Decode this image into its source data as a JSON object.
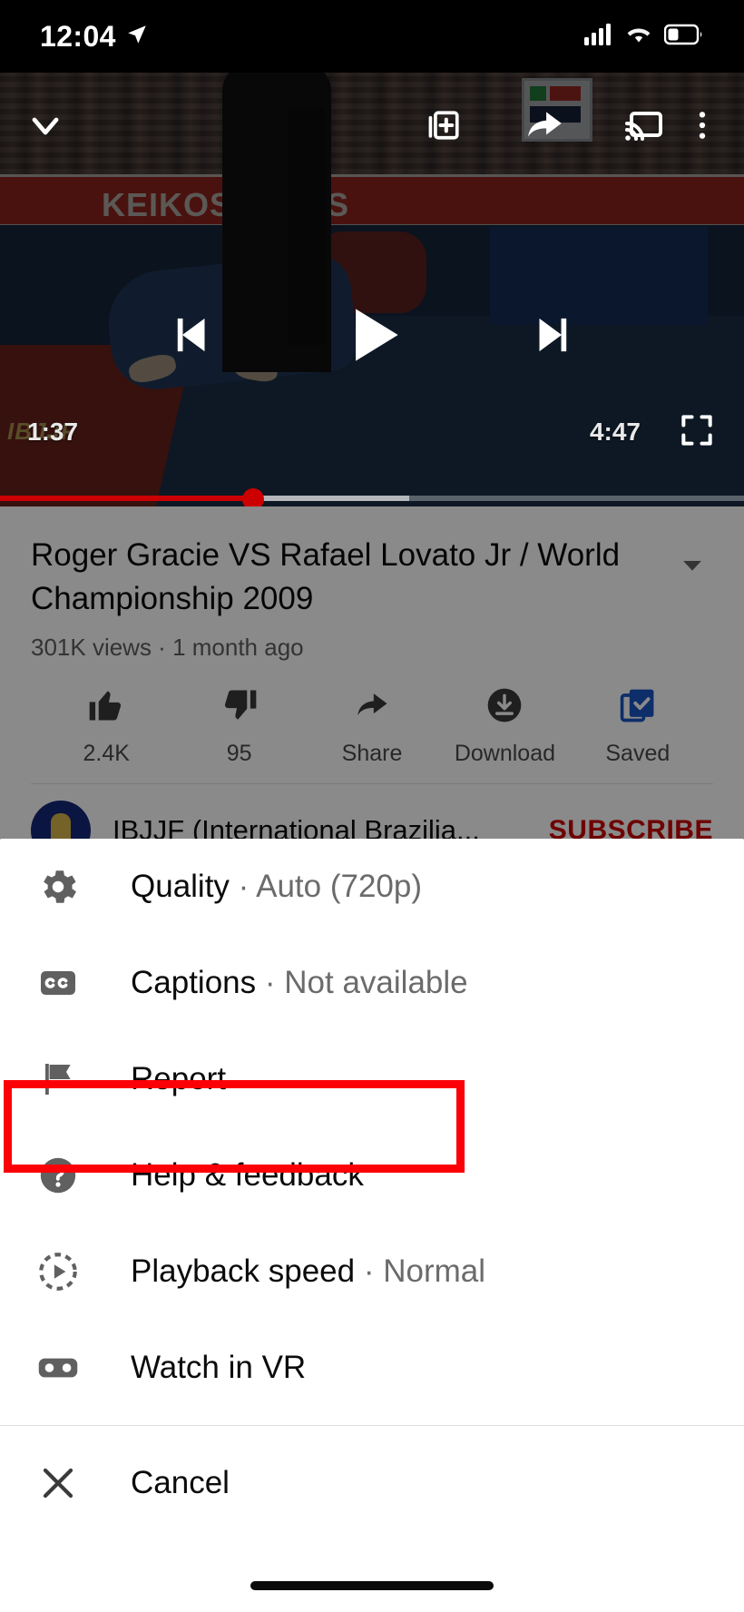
{
  "status_bar": {
    "time": "12:04",
    "location_icon": "location-arrow-icon",
    "signal_icon": "cellular-signal-icon",
    "wifi_icon": "wifi-icon",
    "battery_icon": "battery-low-icon",
    "battery_level_percent": 30
  },
  "player": {
    "collapse_icon": "chevron-down-icon",
    "add_to_playlist_icon": "add-to-queue-icon",
    "share_icon": "share-arrow-icon",
    "cast_icon": "cast-icon",
    "more_icon": "more-vertical-icon",
    "previous_icon": "previous-track-icon",
    "play_icon": "play-icon",
    "next_icon": "next-track-icon",
    "current_time": "1:37",
    "duration": "4:47",
    "fullscreen_icon": "fullscreen-icon",
    "progress_percent": 34,
    "buffered_percent": 55,
    "accent_color": "#cc0000",
    "banner_text": "KEIKOSPORTS",
    "watermark": "IBJJF"
  },
  "video_meta": {
    "title": "Roger Gracie VS Rafael Lovato Jr / World Championship 2009",
    "expand_icon": "chevron-down-icon",
    "views": "301K views",
    "separator": "·",
    "published": "1 month ago",
    "stats_line": "301K views · 1 month ago",
    "actions": [
      {
        "icon": "thumbs-up-icon",
        "label": "2.4K"
      },
      {
        "icon": "thumbs-down-icon",
        "label": "95"
      },
      {
        "icon": "share-arrow-icon",
        "label": "Share"
      },
      {
        "icon": "download-icon",
        "label": "Download"
      },
      {
        "icon": "saved-library-icon",
        "label": "Saved",
        "active_color": "#1a56c4"
      }
    ],
    "channel": {
      "avatar": "ibjjf-channel-avatar",
      "name": "IBJJF (International Brazilia...",
      "subscribe_label": "SUBSCRIBE",
      "subscribe_color": "#cc0000"
    }
  },
  "sheet": {
    "items": [
      {
        "icon": "gear-icon",
        "label": "Quality",
        "separator": "·",
        "value": "Auto (720p)"
      },
      {
        "icon": "closed-captions-icon",
        "label": "Captions",
        "separator": "·",
        "value": "Not available"
      },
      {
        "icon": "flag-icon",
        "label": "Report",
        "separator": "",
        "value": ""
      },
      {
        "icon": "help-circle-icon",
        "label": "Help & feedback",
        "separator": "",
        "value": ""
      },
      {
        "icon": "playback-speed-icon",
        "label": "Playback speed",
        "separator": "·",
        "value": "Normal"
      },
      {
        "icon": "vr-goggles-icon",
        "label": "Watch in VR",
        "separator": "",
        "value": ""
      }
    ],
    "cancel": {
      "icon": "close-icon",
      "label": "Cancel"
    }
  },
  "annotation": {
    "target": "Playback speed · Normal",
    "color": "#fb0007"
  }
}
